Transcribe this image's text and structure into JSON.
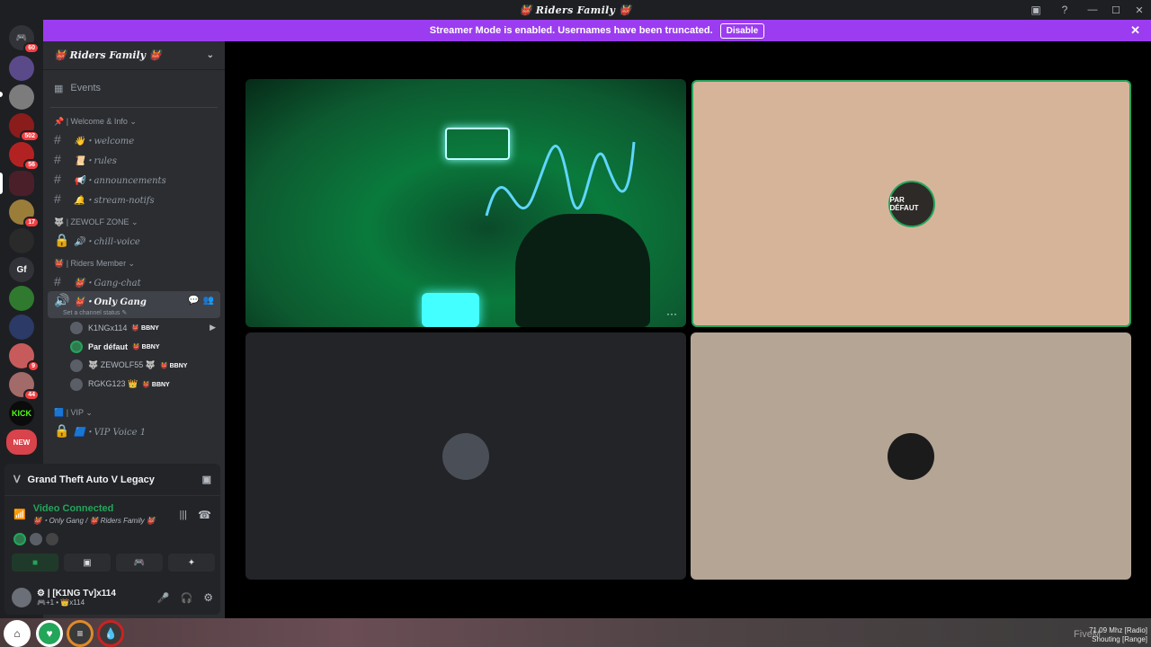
{
  "window": {
    "title": "👹 Riders Family 👹"
  },
  "banner": {
    "text": "Streamer Mode is enabled. Usernames have been truncated.",
    "button": "Disable"
  },
  "guild_badges": [
    "60",
    "502",
    "56",
    "17",
    "9",
    "44",
    "NEW"
  ],
  "guild_labels": {
    "gf": "Gf",
    "kick": "KICK"
  },
  "server": {
    "name": "👹 Riders Family 👹"
  },
  "sidebar": {
    "events": "Events",
    "categories": [
      {
        "label": "📌 | Welcome & Info ⌄"
      },
      {
        "label": "🐺 | ZEWOLF ZONE ⌄"
      },
      {
        "label": "👹 | Riders Member ⌄"
      },
      {
        "label": "🟦 | VIP ⌄"
      }
    ],
    "channels": {
      "welcome": "👋・welcome",
      "rules": "📜・rules",
      "announcements": "📢・announcements",
      "stream_notifs": "🔔・stream-notifs",
      "chill_voice": "🔊・chill-voice",
      "gang_chat": "👹・Gang-chat",
      "only_gang": "👹・Only Gang",
      "only_gang_status": "Set a channel status ✎",
      "vip_voice": "🟦・VIP Voice 1"
    },
    "voice_users": [
      {
        "name": "K1NGx114",
        "tag": "👹 BBNY"
      },
      {
        "name": "Par défaut",
        "tag": "👹 BBNY"
      },
      {
        "name": "🐺 ZEWOLF55 🐺",
        "tag": "👹 BBNY"
      },
      {
        "name": "RGKG123 👑",
        "tag": "👹 BBNY"
      }
    ]
  },
  "panel": {
    "game": "Grand Theft Auto V Legacy",
    "status": "Video Connected",
    "location": "👹・Only Gang / 👹 Riders Family 👹",
    "user_name": "⚙ | [K1NG Tv]x114",
    "user_status": "🎮+1 • 👑x114"
  },
  "stage": {
    "tile2_label": "PAR DÉFAUT",
    "more": "···"
  },
  "hud": {
    "radio_line1": "71.09 Mhz [Radio]",
    "radio_line2": "Shouting [Range]",
    "watermark": "FiveM"
  }
}
